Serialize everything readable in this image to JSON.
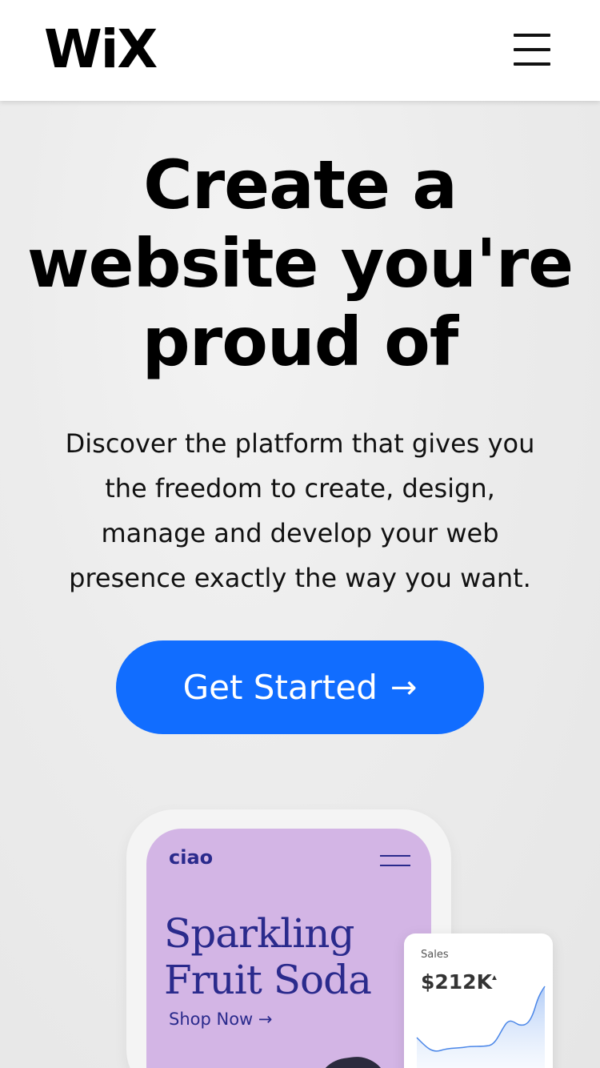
{
  "header": {
    "logo_text": "WiX",
    "menu_icon": "hamburger-menu-icon"
  },
  "hero": {
    "headline_line1": "Create a",
    "headline_line2": "website you're",
    "headline_line3": "proud of",
    "subtext_line1": "Discover the platform that gives you",
    "subtext_line2": "the freedom to create, design,",
    "subtext_line3": "manage and develop your web",
    "subtext_line4": "presence exactly the way you want.",
    "cta_label": "Get Started",
    "cta_icon": "arrow-right-icon"
  },
  "preview": {
    "brand": "ciao",
    "menu_icon": "hamburger-menu-icon",
    "title_line1": "Sparkling",
    "title_line2": "Fruit Soda",
    "shop_now_label": "Shop Now",
    "shop_now_icon": "arrow-right-icon"
  },
  "sales_card": {
    "label": "Sales",
    "value": "$212K",
    "trend_icon": "caret-up-icon"
  },
  "colors": {
    "accent": "#116dff",
    "preview_bg": "#d3b5e5",
    "preview_text": "#2a2a8c"
  }
}
